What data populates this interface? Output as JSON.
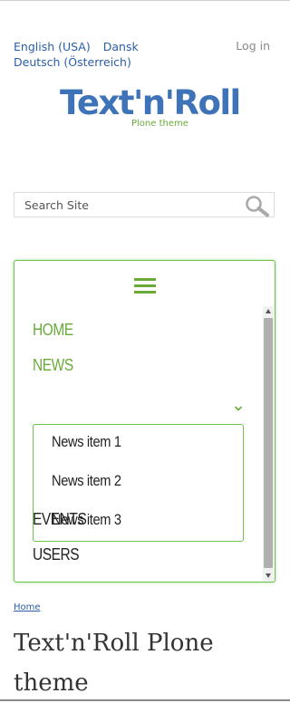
{
  "languages": [
    {
      "label": "English (USA)"
    },
    {
      "label": "Dansk"
    },
    {
      "label": "Deutsch (Österreich)"
    }
  ],
  "login_label": "Log in",
  "logo": {
    "wordmark": "Text'n'Roll",
    "tagline": "Plone theme",
    "colors": {
      "wordmark": "#3e73b8",
      "accent": "#6aaa3a"
    }
  },
  "search": {
    "placeholder": "Search Site",
    "button_icon": "search-icon"
  },
  "nav": {
    "toggle_icon": "hamburger-menu-icon",
    "accent_color": "#6cc24a",
    "items": [
      {
        "label": "HOME",
        "active": true
      },
      {
        "label": "NEWS",
        "active": true,
        "expanded": true,
        "icon": "chevron-down-icon"
      },
      {
        "label": "EVENTS",
        "active": false
      },
      {
        "label": "USERS",
        "active": false
      }
    ],
    "news_subitems": [
      {
        "label": "News item 1"
      },
      {
        "label": "News item 2"
      },
      {
        "label": "News item 3"
      }
    ]
  },
  "breadcrumb": {
    "label": "Home"
  },
  "page_title": "Text'n'Roll Plone theme"
}
